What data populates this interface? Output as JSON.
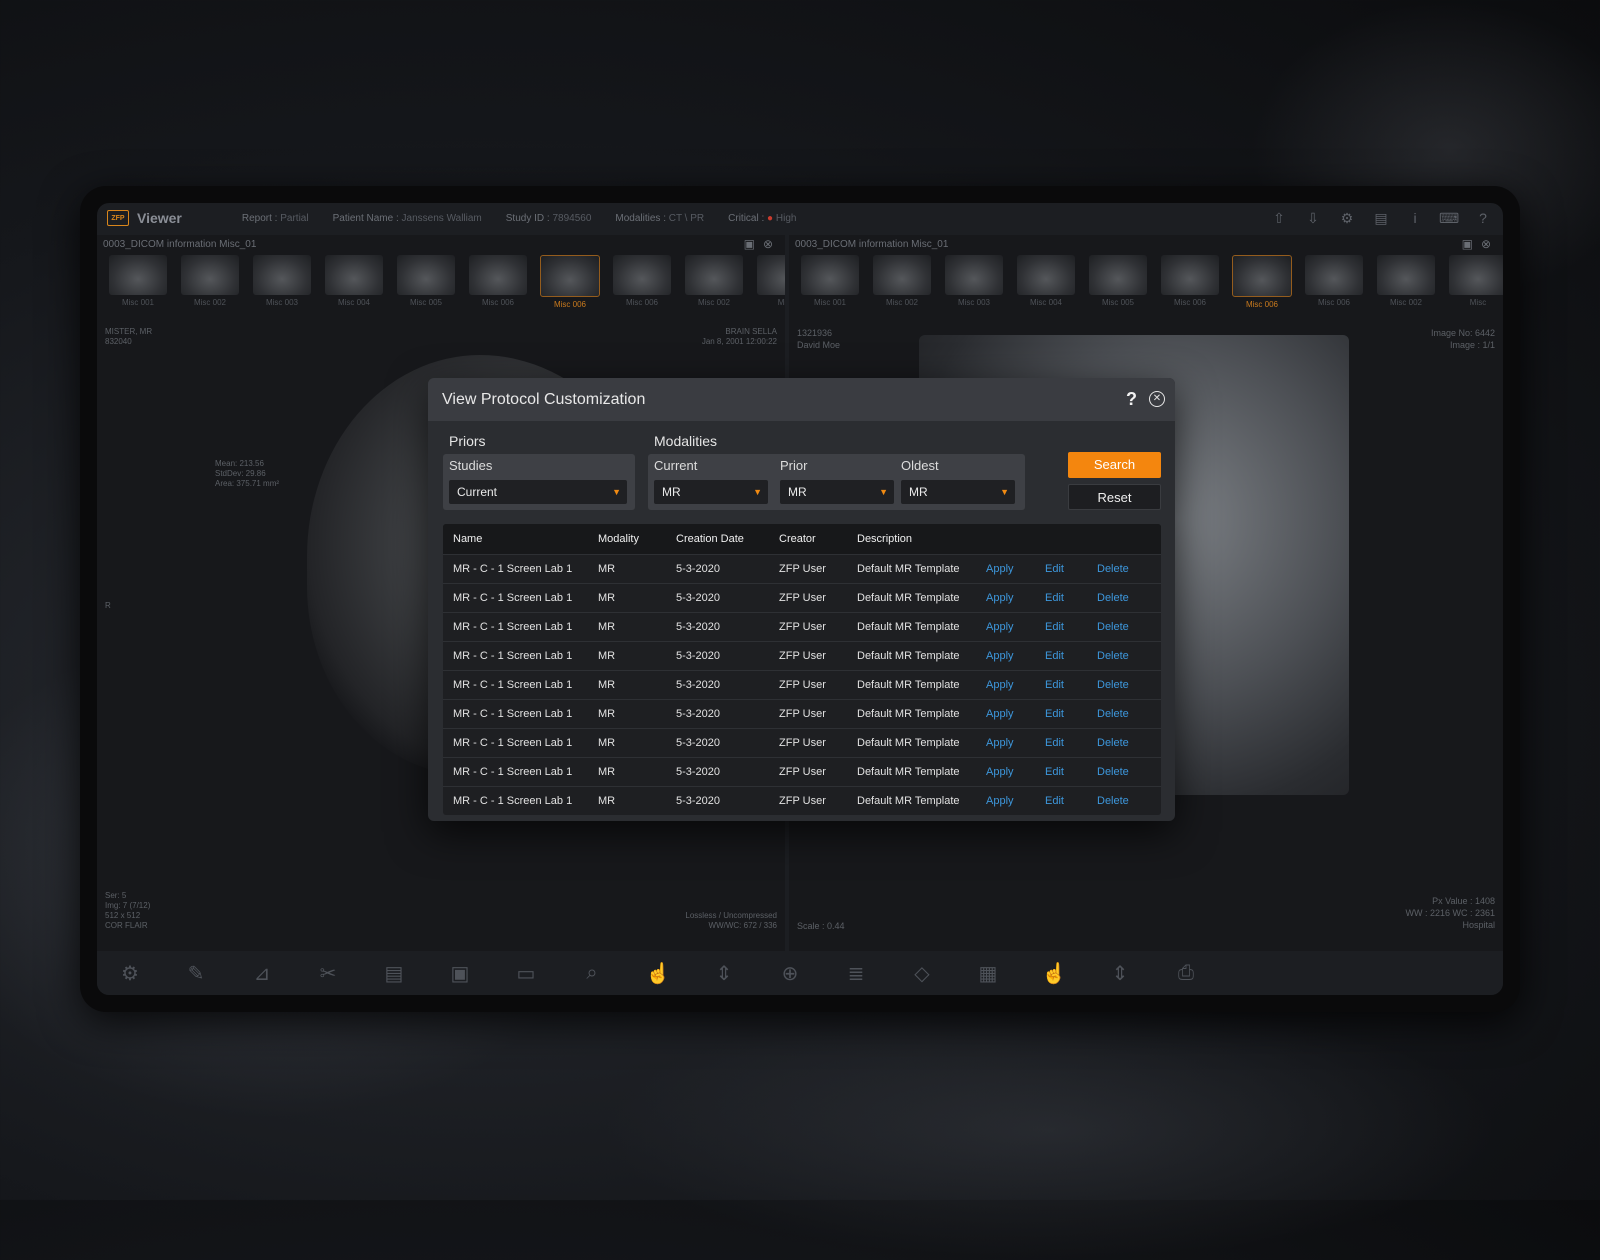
{
  "app": {
    "title": "Viewer",
    "logo_text": "ZFP"
  },
  "topbar": {
    "report_label": "Report :",
    "report_value": "Partial",
    "patient_label": "Patient Name :",
    "patient_value": "Janssens Walliam",
    "study_label": "Study ID :",
    "study_value": "7894560",
    "modalities_label": "Modalities :",
    "modalities_value": "CT \\ PR",
    "critical_label": "Critical :",
    "critical_value": "High",
    "icons": [
      "upload-icon",
      "download-icon",
      "settings-icon",
      "report-icon",
      "info-icon",
      "keyboard-icon",
      "help-icon"
    ]
  },
  "left_pane": {
    "title": "0003_DICOM information Misc_01",
    "thumbs": [
      "Misc 001",
      "Misc 002",
      "Misc 003",
      "Misc 004",
      "Misc 005",
      "Misc 006",
      "Misc 006",
      "Misc 006",
      "Misc 002",
      "Misc"
    ],
    "selected_thumb": 6,
    "tl_text": "MISTER, MR\n832040",
    "tr_text": "BRAIN SELLA\nJan 8, 2001 12:00:22",
    "measure_text": "Mean: 213.56\nStdDev: 29.86\nArea: 375.71 mm²",
    "side_marker": "R",
    "bl_text": "Ser: 5\nImg: 7 (7/12)\n512 x 512\nCOR FLAIR",
    "br_text": "Lossless / Uncompressed\nWW/WC: 672 / 336"
  },
  "right_pane": {
    "title": "0003_DICOM information Misc_01",
    "thumbs": [
      "Misc 001",
      "Misc 002",
      "Misc 003",
      "Misc 004",
      "Misc 005",
      "Misc 006",
      "Misc 006",
      "Misc 006",
      "Misc 002",
      "Misc"
    ],
    "selected_thumb": 6,
    "tl_text": "1321936\nDavid Moe",
    "tr_text": "Image No: 6442\nImage : 1/1",
    "bl_text": "Scale : 0.44",
    "br_text": "Px Value : 1408\nWW : 2216 WC : 2361\nHospital"
  },
  "toolbar": {
    "icons": [
      "gear-icon",
      "edit-icon",
      "measure-icon",
      "tools-icon",
      "document-icon",
      "save-icon",
      "layout-icon",
      "zoom-icon",
      "pan-icon",
      "scroll-icon",
      "crosshair-icon",
      "stack-icon",
      "layers-icon",
      "grid-icon",
      "touch-icon",
      "navigate-icon",
      "print-icon"
    ]
  },
  "modal": {
    "title": "View Protocol Customization",
    "help": "?",
    "close": "✕",
    "priors_label": "Priors",
    "studies_label": "Studies",
    "studies_value": "Current",
    "modalities_label": "Modalities",
    "current_label": "Current",
    "current_value": "MR",
    "prior_label": "Prior",
    "prior_value": "MR",
    "oldest_label": "Oldest",
    "oldest_value": "MR",
    "search_btn": "Search",
    "reset_btn": "Reset",
    "columns": [
      "Name",
      "Modality",
      "Creation Date",
      "Creator",
      "Description"
    ],
    "rows": [
      {
        "name": "MR - C - 1 Screen Lab 1",
        "modality": "MR",
        "date": "5-3-2020",
        "creator": "ZFP User",
        "description": "Default MR Template",
        "apply": "Apply",
        "edit": "Edit",
        "delete": "Delete"
      },
      {
        "name": "MR - C - 1 Screen Lab 1",
        "modality": "MR",
        "date": "5-3-2020",
        "creator": "ZFP User",
        "description": "Default MR Template",
        "apply": "Apply",
        "edit": "Edit",
        "delete": "Delete"
      },
      {
        "name": "MR - C - 1 Screen Lab 1",
        "modality": "MR",
        "date": "5-3-2020",
        "creator": "ZFP User",
        "description": "Default MR Template",
        "apply": "Apply",
        "edit": "Edit",
        "delete": "Delete"
      },
      {
        "name": "MR - C - 1 Screen Lab 1",
        "modality": "MR",
        "date": "5-3-2020",
        "creator": "ZFP User",
        "description": "Default MR Template",
        "apply": "Apply",
        "edit": "Edit",
        "delete": "Delete"
      },
      {
        "name": "MR - C - 1 Screen Lab 1",
        "modality": "MR",
        "date": "5-3-2020",
        "creator": "ZFP User",
        "description": "Default MR Template",
        "apply": "Apply",
        "edit": "Edit",
        "delete": "Delete"
      },
      {
        "name": "MR - C - 1 Screen Lab 1",
        "modality": "MR",
        "date": "5-3-2020",
        "creator": "ZFP User",
        "description": "Default MR Template",
        "apply": "Apply",
        "edit": "Edit",
        "delete": "Delete"
      },
      {
        "name": "MR - C - 1 Screen Lab 1",
        "modality": "MR",
        "date": "5-3-2020",
        "creator": "ZFP User",
        "description": "Default MR Template",
        "apply": "Apply",
        "edit": "Edit",
        "delete": "Delete"
      },
      {
        "name": "MR - C - 1 Screen Lab 1",
        "modality": "MR",
        "date": "5-3-2020",
        "creator": "ZFP User",
        "description": "Default MR Template",
        "apply": "Apply",
        "edit": "Edit",
        "delete": "Delete"
      },
      {
        "name": "MR - C - 1 Screen Lab 1",
        "modality": "MR",
        "date": "5-3-2020",
        "creator": "ZFP User",
        "description": "Default MR Template",
        "apply": "Apply",
        "edit": "Edit",
        "delete": "Delete"
      }
    ]
  },
  "colors": {
    "accent": "#f4860e",
    "link": "#3d97dc",
    "critical": "#c93b2e"
  }
}
